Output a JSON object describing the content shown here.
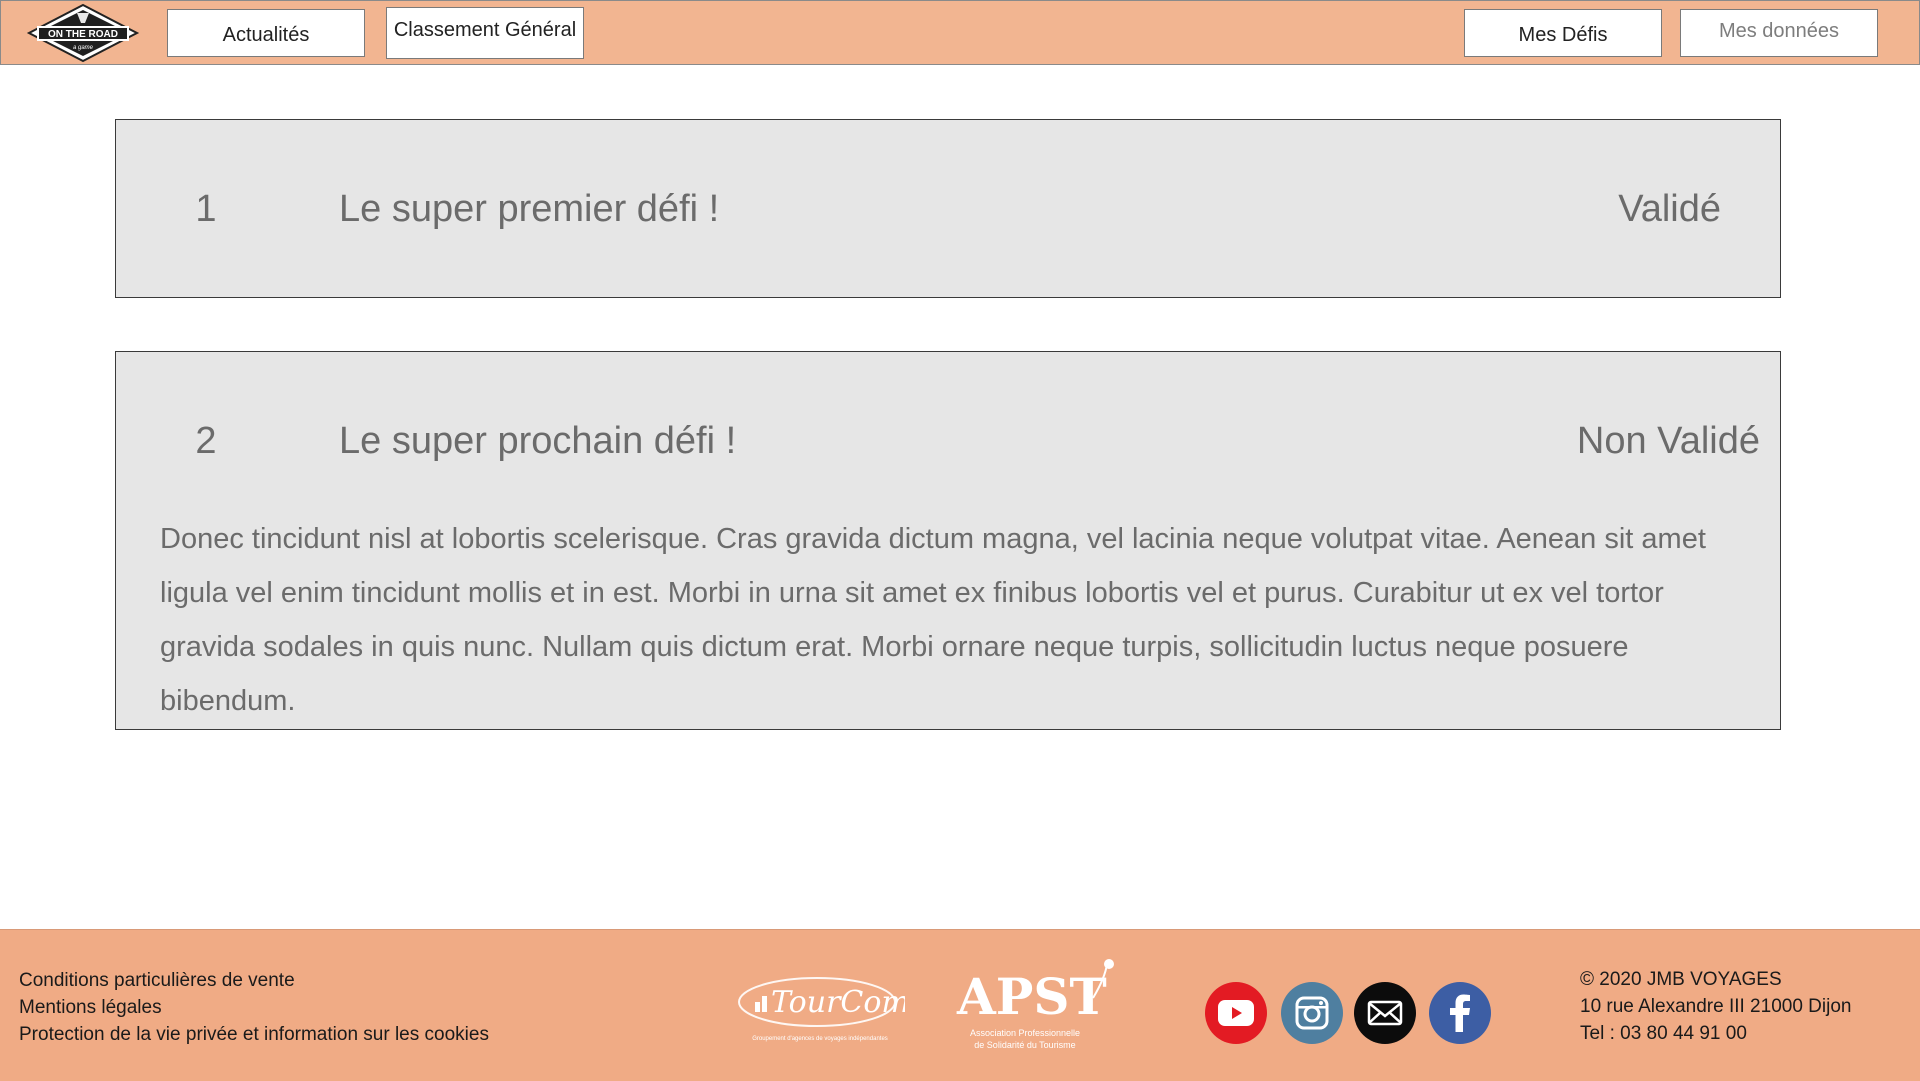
{
  "header": {
    "logo_text": "ON THE ROAD",
    "logo_subtext": "a game",
    "nav": {
      "actualites": "Actualités",
      "classement": "Classement Général",
      "defis": "Mes Défis",
      "donnees": "Mes données"
    }
  },
  "challenges": [
    {
      "number": "1",
      "title": "Le super premier défi !",
      "status": "Validé"
    },
    {
      "number": "2",
      "title": "Le super prochain défi !",
      "status": "Non Validé",
      "description": "Donec tincidunt nisl at lobortis scelerisque. Cras gravida dictum magna, vel lacinia neque volutpat vitae. Aenean sit amet ligula vel enim tincidunt mollis et in est. Morbi in urna sit amet ex finibus lobortis vel et purus. Curabitur ut ex vel tortor gravida sodales in quis nunc. Nullam quis dictum erat. Morbi ornare neque turpis, sollicitudin luctus neque posuere bibendum."
    }
  ],
  "footer": {
    "links": [
      "Conditions particulières de vente",
      "Mentions légales",
      "Protection de la vie privée et information sur les cookies"
    ],
    "partners": {
      "tourcom": "TourCom",
      "tourcom_tagline": "Groupement d'agences de voyages indépendantes",
      "apst": "APST",
      "apst_tagline_1": "Association Professionnelle",
      "apst_tagline_2": "de Solidarité du Tourisme"
    },
    "social_icons": [
      "youtube-icon",
      "instagram-icon",
      "mail-icon",
      "facebook-icon"
    ],
    "contact": {
      "copyright": "© 2020 JMB VOYAGES",
      "address": "10 rue Alexandre III 21000 Dijon",
      "phone": "Tel : 03 80 44 91 00"
    }
  },
  "colors": {
    "header_bg": "#f2b591",
    "footer_bg": "#f0ab85",
    "card_bg": "#e6e6e6",
    "youtube": "#e31b23",
    "instagram": "#4f7fa0",
    "mail": "#0c0c0c",
    "facebook": "#3d5ea4"
  }
}
